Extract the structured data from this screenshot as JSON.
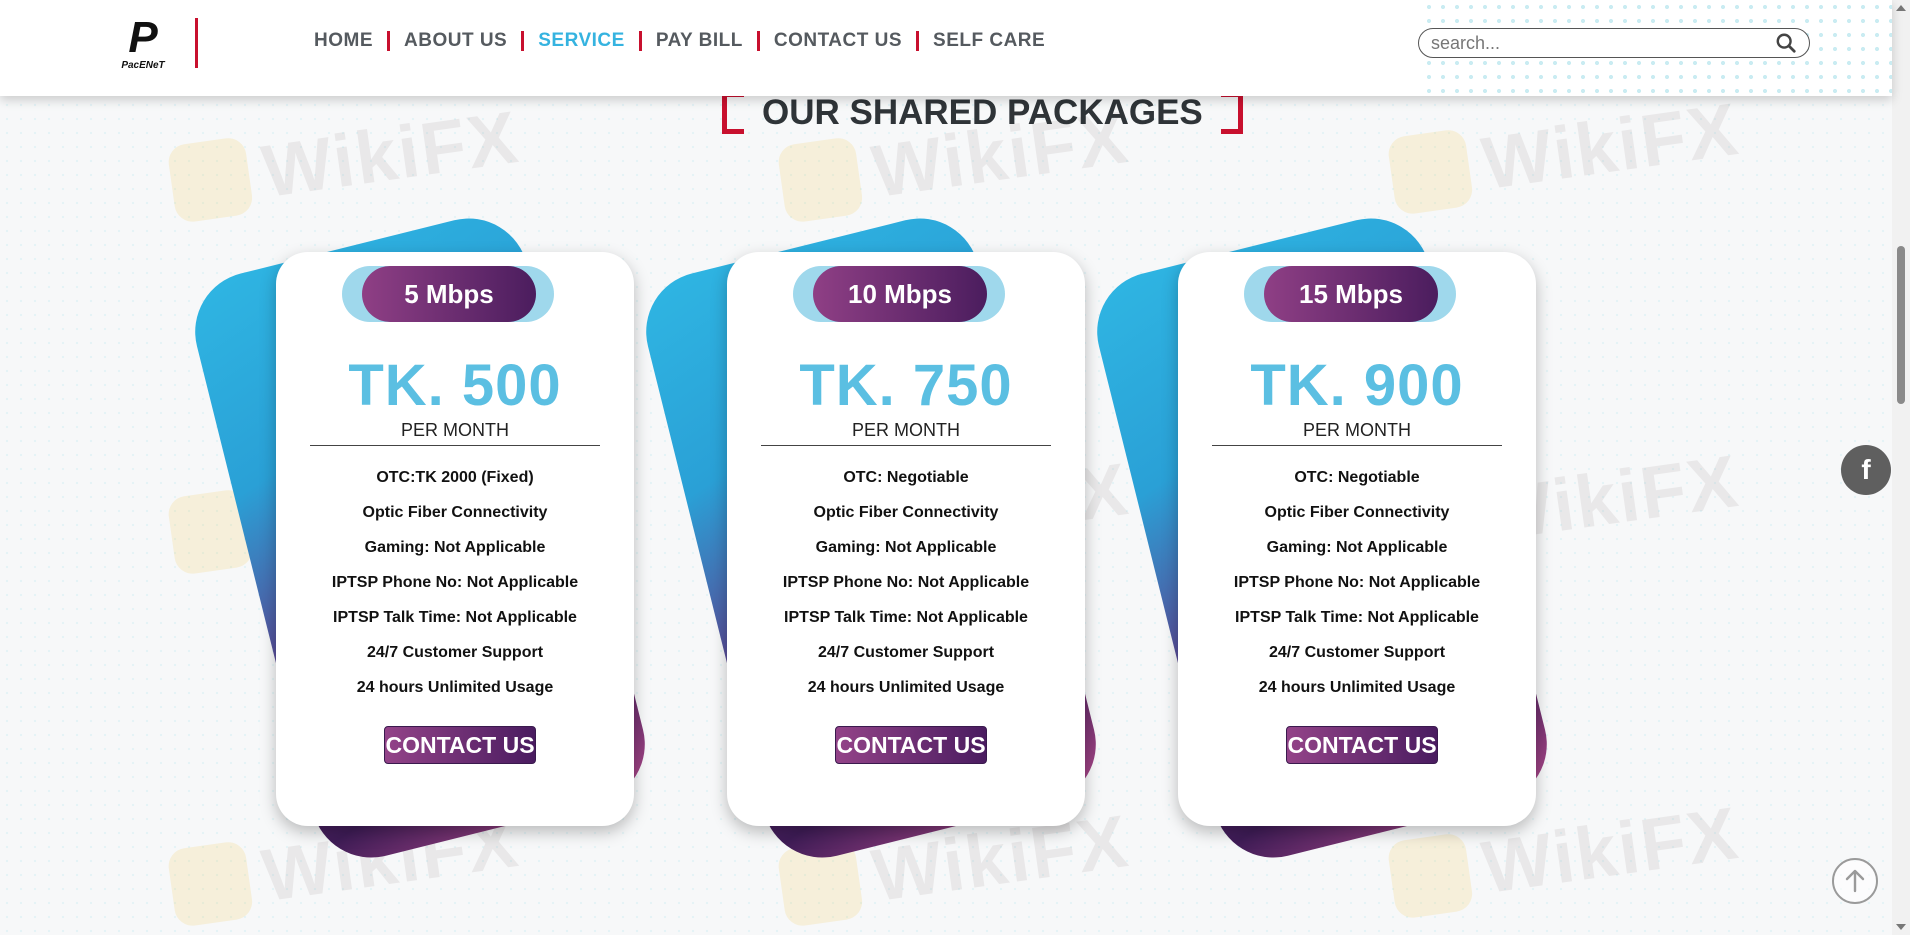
{
  "brand": {
    "logo_mark": "P",
    "logo_text": "PacENeT"
  },
  "nav": {
    "items": [
      {
        "label": "HOME"
      },
      {
        "label": "ABOUT US"
      },
      {
        "label": "SERVICE"
      },
      {
        "label": "PAY BILL"
      },
      {
        "label": "CONTACT US"
      },
      {
        "label": "SELF CARE"
      }
    ],
    "active_index": 2
  },
  "search": {
    "placeholder": "search..."
  },
  "section": {
    "title": "OUR SHARED PACKAGES"
  },
  "watermark": {
    "text": "WikiFX"
  },
  "packages": [
    {
      "speed": "5 Mbps",
      "price": "TK. 500",
      "period": "PER MONTH",
      "features": [
        "OTC:TK 2000 (Fixed)",
        "Optic Fiber Connectivity",
        "Gaming: Not Applicable",
        "IPTSP Phone No: Not Applicable",
        "IPTSP Talk Time: Not Applicable",
        "24/7 Customer Support",
        "24 hours Unlimited Usage"
      ],
      "button": "CONTACT US"
    },
    {
      "speed": "10 Mbps",
      "price": "TK. 750",
      "period": "PER MONTH",
      "features": [
        "OTC: Negotiable",
        "Optic Fiber Connectivity",
        "Gaming: Not Applicable",
        "IPTSP Phone No: Not Applicable",
        "IPTSP Talk Time: Not Applicable",
        "24/7 Customer Support",
        "24 hours Unlimited Usage"
      ],
      "button": "CONTACT US"
    },
    {
      "speed": "15 Mbps",
      "price": "TK. 900",
      "period": "PER MONTH",
      "features": [
        "OTC: Negotiable",
        "Optic Fiber Connectivity",
        "Gaming: Not Applicable",
        "IPTSP Phone No: Not Applicable",
        "IPTSP Talk Time: Not Applicable",
        "24/7 Customer Support",
        "24 hours Unlimited Usage"
      ],
      "button": "CONTACT US"
    }
  ],
  "floating": {
    "facebook_label": "f"
  },
  "colors": {
    "accent_red": "#c8102e",
    "accent_blue": "#35b3e0",
    "price_blue": "#5bbfe2",
    "purple_dark": "#4a1c60",
    "purple_light": "#934388"
  }
}
